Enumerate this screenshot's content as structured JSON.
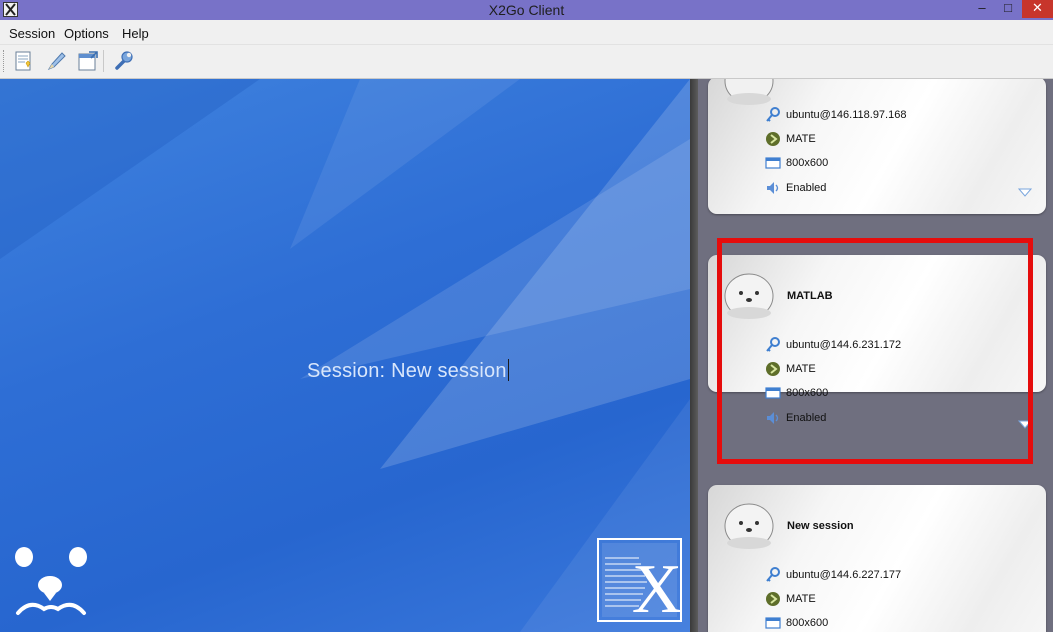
{
  "window": {
    "title": "X2Go Client",
    "controls": {
      "minimize": "–",
      "maximize": "□",
      "close": "✕"
    }
  },
  "menubar": {
    "items": [
      "Session",
      "Options",
      "Help"
    ]
  },
  "toolbar": {
    "buttons": [
      "new-session-icon",
      "edit-session-icon",
      "session-export-icon",
      "preferences-wrench-icon"
    ]
  },
  "main": {
    "session_prefix": "Session:",
    "session_name": "New session"
  },
  "sessions": [
    {
      "name": "",
      "login": "ubuntu@146.118.97.168",
      "desktop": "MATE",
      "resolution": "800x600",
      "sound": "Enabled"
    },
    {
      "name": "MATLAB",
      "login": "ubuntu@144.6.231.172",
      "desktop": "MATE",
      "resolution": "800x600",
      "sound": "Enabled"
    },
    {
      "name": "New session",
      "login": "ubuntu@144.6.227.177",
      "desktop": "MATE",
      "resolution": "800x600",
      "sound": ""
    }
  ],
  "colors": {
    "titlebar": "#7872c8",
    "highlight": "#e50c0c",
    "main_bg": "#2e6ed5",
    "close": "#c7352b"
  }
}
